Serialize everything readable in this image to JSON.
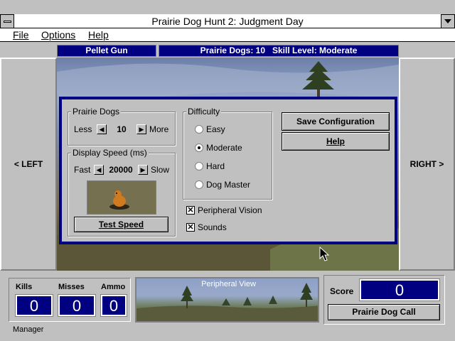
{
  "window": {
    "title": "Prairie Dog Hunt 2: Judgment Day"
  },
  "menu": [
    {
      "label": "File"
    },
    {
      "label": "Options"
    },
    {
      "label": "Help"
    }
  ],
  "status": {
    "weapon": "Pellet Gun",
    "info": "Prairie Dogs: 10   Skill Level: Moderate"
  },
  "nav": {
    "left": "< LEFT",
    "right": "RIGHT >"
  },
  "config": {
    "prairie_dogs": {
      "label": "Prairie Dogs",
      "less": "Less",
      "more": "More",
      "value": "10"
    },
    "display_speed": {
      "label": "Display Speed (ms)",
      "fast": "Fast",
      "slow": "Slow",
      "value": "20000"
    },
    "test_speed": "Test Speed",
    "difficulty": {
      "label": "Difficulty",
      "options": [
        "Easy",
        "Moderate",
        "Hard",
        "Dog Master"
      ],
      "selected": "Moderate"
    },
    "peripheral_vision": {
      "label": "Peripheral Vision",
      "checked": true
    },
    "sounds": {
      "label": "Sounds",
      "checked": true
    },
    "save": "Save Configuration",
    "help": "Help"
  },
  "stats": {
    "kills": {
      "label": "Kills",
      "value": "0"
    },
    "misses": {
      "label": "Misses",
      "value": "0"
    },
    "ammo": {
      "label": "Ammo",
      "value": "0"
    }
  },
  "peripheral": {
    "label": "Peripheral View"
  },
  "score": {
    "label": "Score",
    "value": "0"
  },
  "call_button": "Prairie Dog Call",
  "taskbar_label": "Manager",
  "colors": {
    "title_blue": "#000080",
    "face": "#c0c0c0",
    "lcd": "#000080"
  }
}
